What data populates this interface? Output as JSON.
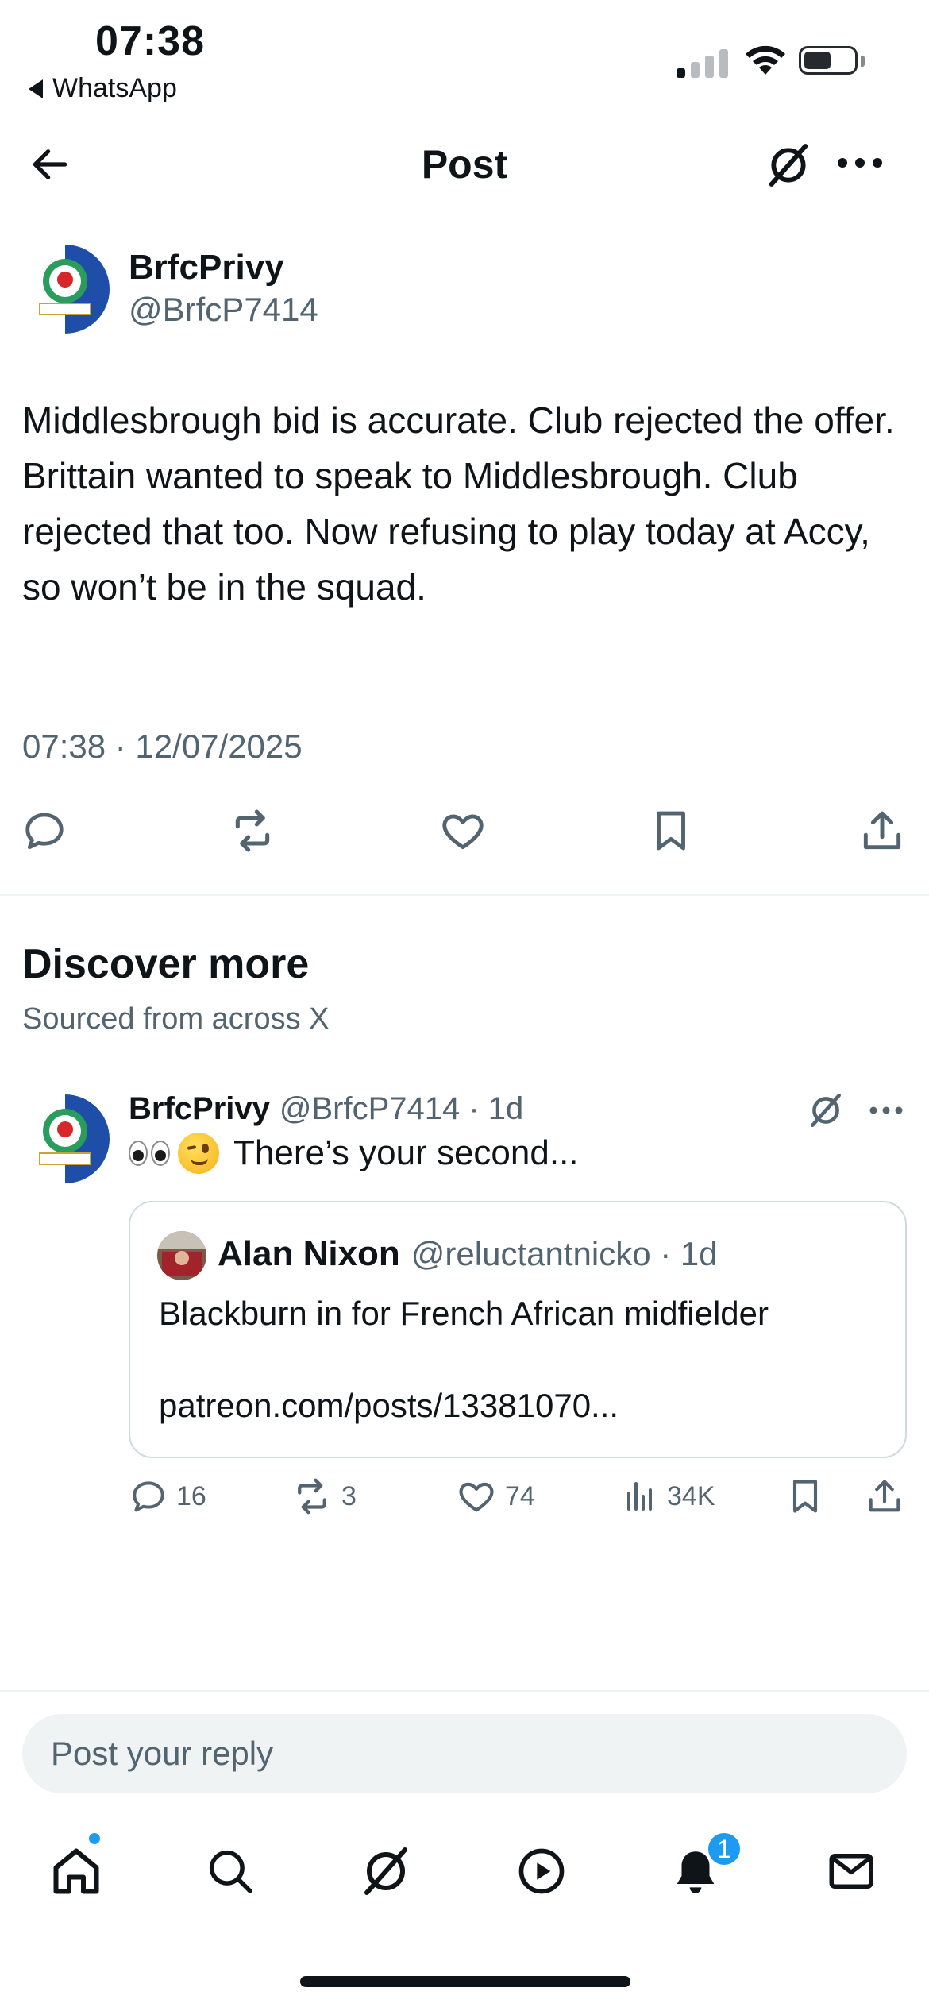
{
  "status_bar": {
    "time": "07:38",
    "back_app": "WhatsApp",
    "signal_bars_on": 1,
    "battery_level_pct": 55
  },
  "header": {
    "title": "Post",
    "back_icon": "arrow-left-icon",
    "grok_icon": "grok-icon",
    "more_icon": "more-horizontal-icon"
  },
  "post": {
    "author_name": "BrfcPrivy",
    "author_handle": "@BrfcP7414",
    "text": "Middlesbrough bid is accurate. Club rejected the offer. Brittain wanted to speak to Middlesbrough. Club rejected that too. Now refusing to play today at Accy, so won’t be in the squad.",
    "meta": "07:38 · 12/07/2025"
  },
  "discover": {
    "title": "Discover more",
    "subtitle": "Sourced from across X"
  },
  "recommended_post": {
    "author_name": "BrfcPrivy",
    "author_handle": "@BrfcP7414 · 1d",
    "text": "There’s your second...",
    "quote": {
      "author_name": "Alan Nixon",
      "author_handle": "@reluctantnicko · 1d",
      "line1": "Blackburn in for French African midfielder",
      "line2": "patreon.com/posts/13381070..."
    },
    "actions": {
      "replies": "16",
      "reposts": "3",
      "likes": "74",
      "views": "34K"
    }
  },
  "reply_box": {
    "placeholder": "Post your reply"
  },
  "tab_bar": {
    "notifications_badge": "1"
  },
  "colors": {
    "accent": "#1d9bf0",
    "text": "#0f1419",
    "secondary": "#536471",
    "divider": "#eff3f4"
  }
}
